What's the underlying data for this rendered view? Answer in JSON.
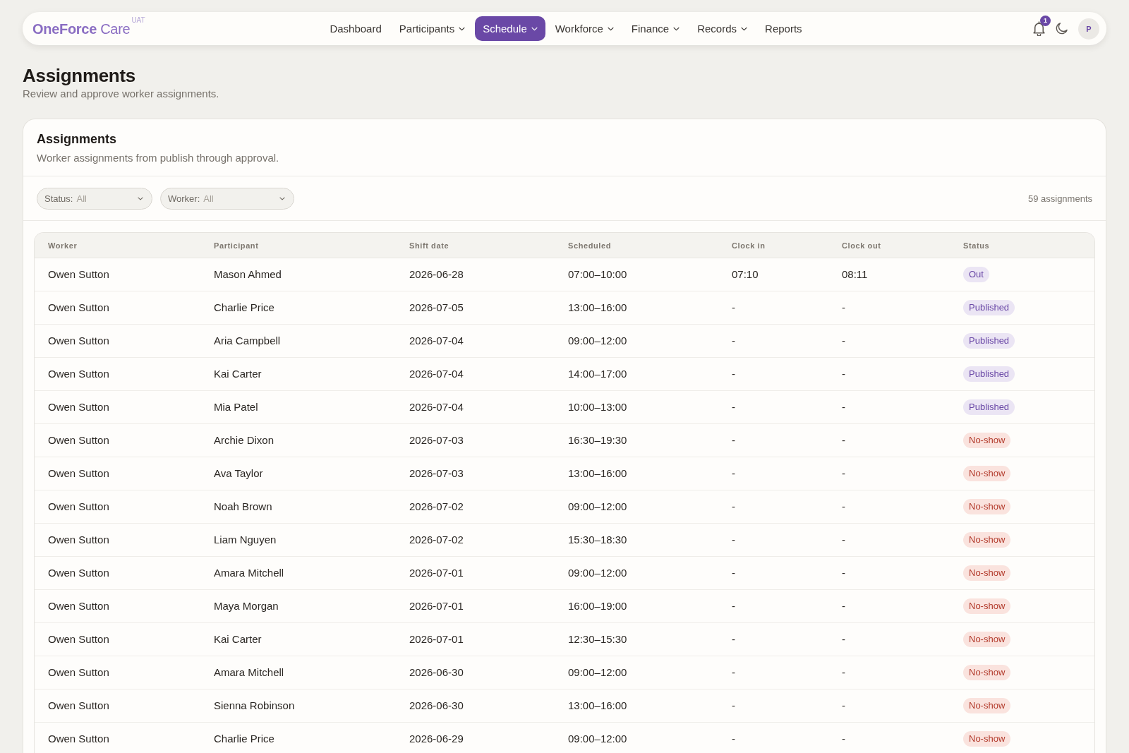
{
  "app": {
    "logo": "**OneForce** Care",
    "environment": "UAT"
  },
  "nav": [
    {
      "label": "Dashboard",
      "dropdown": false,
      "selected": false
    },
    {
      "label": "Participants",
      "dropdown": true,
      "selected": false
    },
    {
      "label": "Schedule",
      "dropdown": true,
      "selected": true
    },
    {
      "label": "Workforce",
      "dropdown": true,
      "selected": false
    },
    {
      "label": "Finance",
      "dropdown": true,
      "selected": false
    },
    {
      "label": "Records",
      "dropdown": true,
      "selected": false
    },
    {
      "label": "Reports",
      "dropdown": false,
      "selected": false
    }
  ],
  "actions": {
    "notifications": "1",
    "avatar": "P"
  },
  "page": {
    "title": "Assignments",
    "subtitle": "Review and approve worker assignments."
  },
  "card": {
    "title": "Assignments",
    "subtitle": "Worker assignments from publish through approval.",
    "filters": [
      {
        "label": "Status:",
        "value": "All"
      },
      {
        "label": "Worker:",
        "value": "All"
      }
    ],
    "count": "59 assignments",
    "table": {
      "columns": [
        "Worker",
        "Participant",
        "Shift date",
        "Scheduled",
        "Clock in",
        "Clock out",
        "Status"
      ],
      "rows": [
        {
          "cells": [
            "Owen Sutton",
            "Mason Ahmed",
            "2026-06-28",
            "07:00–10:00",
            "07:10",
            "08:11"
          ],
          "status": {
            "label": "Out",
            "kind": "info"
          }
        },
        {
          "cells": [
            "Owen Sutton",
            "Charlie Price",
            "2026-07-05",
            "13:00–16:00",
            "-",
            "-"
          ],
          "status": {
            "label": "Published",
            "kind": "info"
          }
        },
        {
          "cells": [
            "Owen Sutton",
            "Aria Campbell",
            "2026-07-04",
            "09:00–12:00",
            "-",
            "-"
          ],
          "status": {
            "label": "Published",
            "kind": "info"
          }
        },
        {
          "cells": [
            "Owen Sutton",
            "Kai Carter",
            "2026-07-04",
            "14:00–17:00",
            "-",
            "-"
          ],
          "status": {
            "label": "Published",
            "kind": "info"
          }
        },
        {
          "cells": [
            "Owen Sutton",
            "Mia Patel",
            "2026-07-04",
            "10:00–13:00",
            "-",
            "-"
          ],
          "status": {
            "label": "Published",
            "kind": "info"
          }
        },
        {
          "cells": [
            "Owen Sutton",
            "Archie Dixon",
            "2026-07-03",
            "16:30–19:30",
            "-",
            "-"
          ],
          "status": {
            "label": "No-show",
            "kind": "alert"
          }
        },
        {
          "cells": [
            "Owen Sutton",
            "Ava Taylor",
            "2026-07-03",
            "13:00–16:00",
            "-",
            "-"
          ],
          "status": {
            "label": "No-show",
            "kind": "alert"
          }
        },
        {
          "cells": [
            "Owen Sutton",
            "Noah Brown",
            "2026-07-02",
            "09:00–12:00",
            "-",
            "-"
          ],
          "status": {
            "label": "No-show",
            "kind": "alert"
          }
        },
        {
          "cells": [
            "Owen Sutton",
            "Liam Nguyen",
            "2026-07-02",
            "15:30–18:30",
            "-",
            "-"
          ],
          "status": {
            "label": "No-show",
            "kind": "alert"
          }
        },
        {
          "cells": [
            "Owen Sutton",
            "Amara Mitchell",
            "2026-07-01",
            "09:00–12:00",
            "-",
            "-"
          ],
          "status": {
            "label": "No-show",
            "kind": "alert"
          }
        },
        {
          "cells": [
            "Owen Sutton",
            "Maya Morgan",
            "2026-07-01",
            "16:00–19:00",
            "-",
            "-"
          ],
          "status": {
            "label": "No-show",
            "kind": "alert"
          }
        },
        {
          "cells": [
            "Owen Sutton",
            "Kai Carter",
            "2026-07-01",
            "12:30–15:30",
            "-",
            "-"
          ],
          "status": {
            "label": "No-show",
            "kind": "alert"
          }
        },
        {
          "cells": [
            "Owen Sutton",
            "Amara Mitchell",
            "2026-06-30",
            "09:00–12:00",
            "-",
            "-"
          ],
          "status": {
            "label": "No-show",
            "kind": "alert"
          }
        },
        {
          "cells": [
            "Owen Sutton",
            "Sienna Robinson",
            "2026-06-30",
            "13:00–16:00",
            "-",
            "-"
          ],
          "status": {
            "label": "No-show",
            "kind": "alert"
          }
        },
        {
          "cells": [
            "Owen Sutton",
            "Charlie Price",
            "2026-06-29",
            "09:00–12:00",
            "-",
            "-"
          ],
          "status": {
            "label": "No-show",
            "kind": "alert"
          }
        }
      ]
    }
  }
}
